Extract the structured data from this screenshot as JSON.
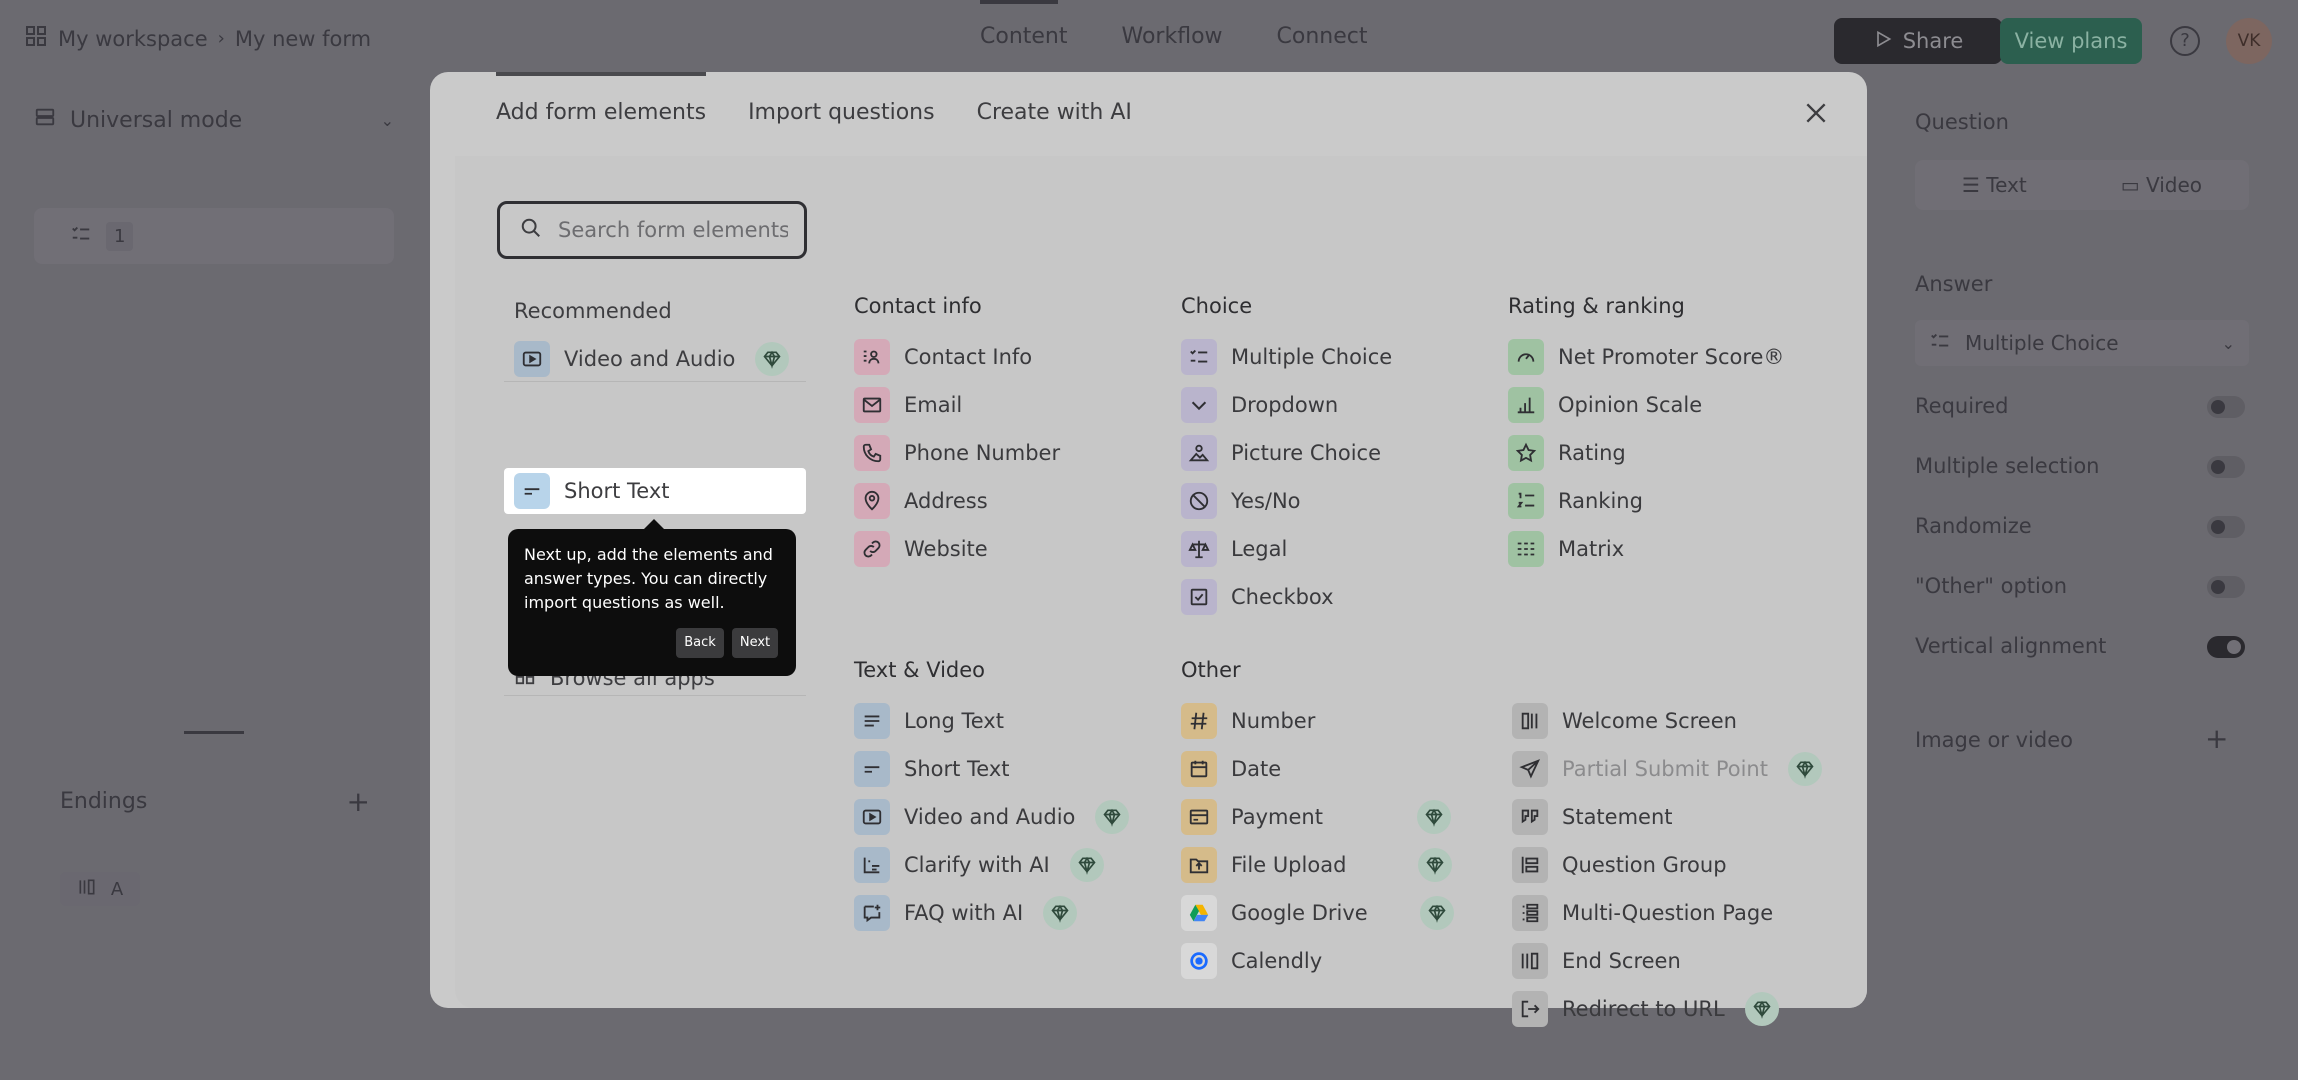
{
  "header": {
    "workspace": "My workspace",
    "form_name": "My new form",
    "nav": [
      "Content",
      "Workflow",
      "Connect"
    ],
    "share_label": "Share",
    "plans_label": "View plans",
    "help_symbol": "?",
    "avatar_initials": "VK"
  },
  "left_panel": {
    "mode_label": "Universal mode",
    "question_number": "1",
    "endings_label": "Endings",
    "ending_letter": "A"
  },
  "right_panel": {
    "question_label": "Question",
    "tab_text": "Text",
    "tab_video": "Video",
    "answer_label": "Answer",
    "answer_value": "Multiple Choice",
    "settings": [
      "Required",
      "Multiple selection",
      "Randomize",
      "\"Other\" option",
      "Vertical alignment"
    ],
    "image_label": "Image or video"
  },
  "modal": {
    "tabs": [
      "Add form elements",
      "Import questions",
      "Create with AI"
    ],
    "search_placeholder": "Search form elements",
    "recommended_title": "Recommended",
    "recommended": [
      {
        "label": "Video and Audio",
        "icon": "video-icon",
        "premium": true
      },
      {
        "label": "Short Text",
        "icon": "short-text-icon",
        "premium": false
      }
    ],
    "browse_all": "Browse all apps",
    "tooltip": {
      "text": "Next up, add the elements and answer types. You can directly import questions as well.",
      "back": "Back",
      "next": "Next"
    },
    "groups": {
      "contact": {
        "title": "Contact info",
        "items": [
          "Contact Info",
          "Email",
          "Phone Number",
          "Address",
          "Website"
        ]
      },
      "choice": {
        "title": "Choice",
        "items": [
          "Multiple Choice",
          "Dropdown",
          "Picture Choice",
          "Yes/No",
          "Legal",
          "Checkbox"
        ]
      },
      "rating": {
        "title": "Rating & ranking",
        "items": [
          "Net Promoter Score®",
          "Opinion Scale",
          "Rating",
          "Ranking",
          "Matrix"
        ]
      },
      "textvideo": {
        "title": "Text & Video",
        "items": [
          "Long Text",
          "Short Text",
          "Video and Audio",
          "Clarify with AI",
          "FAQ with AI"
        ]
      },
      "other": {
        "title": "Other",
        "items": [
          "Number",
          "Date",
          "Payment",
          "File Upload",
          "Google Drive",
          "Calendly"
        ]
      },
      "structure": {
        "items": [
          "Welcome Screen",
          "Partial Submit Point",
          "Statement",
          "Question Group",
          "Multi-Question Page",
          "End Screen",
          "Redirect to URL"
        ]
      }
    }
  },
  "colors": {
    "contact": "#d4a9b7",
    "choice": "#b9b4cc",
    "rating": "#9fc2a2",
    "text": "#a8b9c9",
    "other": "#d5bb8a",
    "structure": "#b3b3b3",
    "premium_badge": "#b2c8bc"
  }
}
